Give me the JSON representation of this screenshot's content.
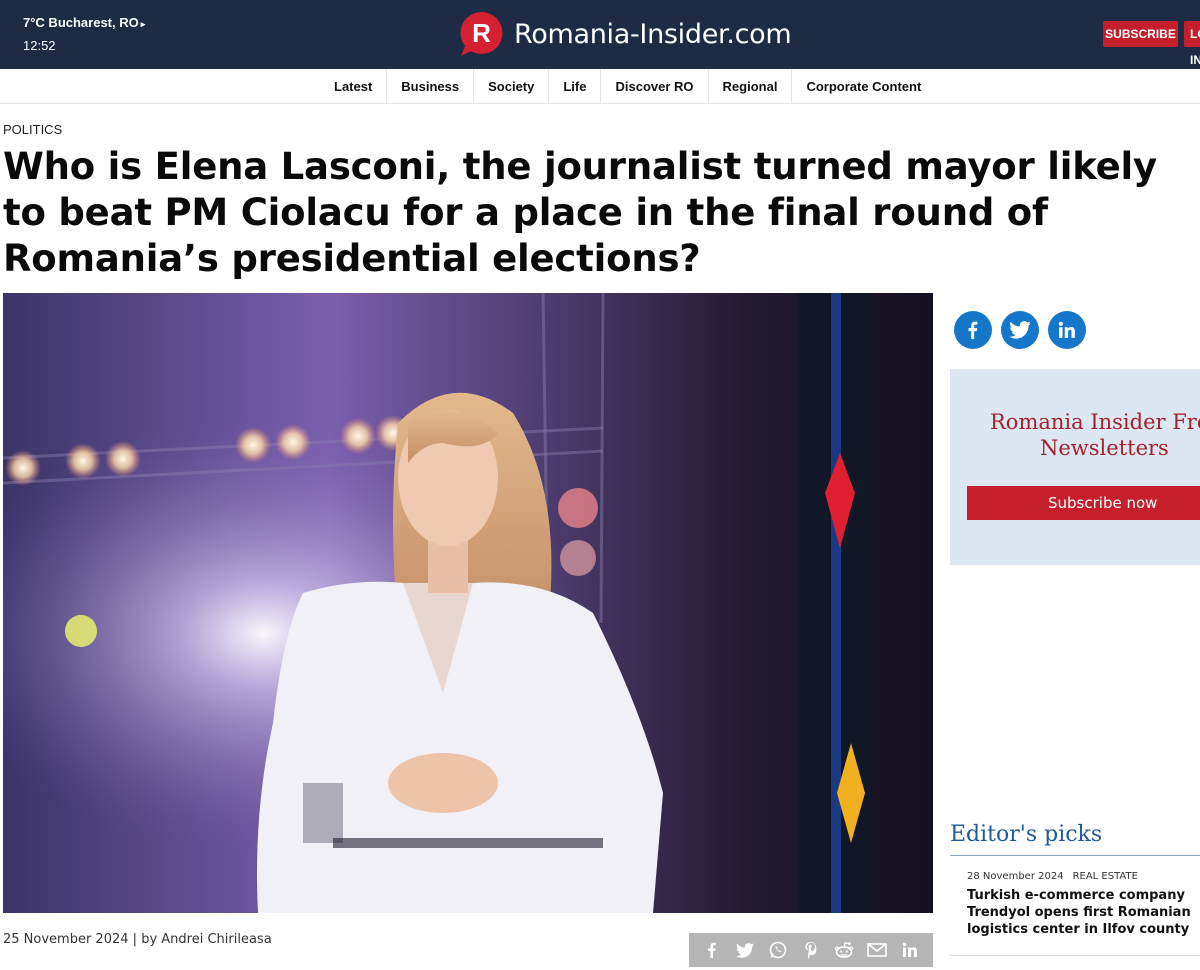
{
  "header": {
    "weather": "7°C Bucharest, RO",
    "weather_arrow": "▸",
    "time": "12:52",
    "logo_letter": "R",
    "site_name": "Romania-Insider.com",
    "subscribe_label": "SUBSCRIBE",
    "login_label": "LOG IN"
  },
  "nav": {
    "items": [
      "Latest",
      "Business",
      "Society",
      "Life",
      "Discover RO",
      "Regional",
      "Corporate Content"
    ]
  },
  "article": {
    "category": "POLITICS",
    "headline": "Who is Elena Lasconi, the journalist turned mayor likely to beat PM Ciolacu for a place in the final round of Romania’s presidential elections?",
    "date": "25 November 2024",
    "author_prefix": "by",
    "author": "Andrei Chirileasa",
    "share_icons": [
      "facebook-icon",
      "twitter-icon",
      "whatsapp-icon",
      "pinterest-icon",
      "reddit-icon",
      "email-icon",
      "linkedin-icon"
    ]
  },
  "sidebar": {
    "social": [
      {
        "icon": "facebook-icon",
        "glyph": "f"
      },
      {
        "icon": "twitter-icon",
        "glyph": ""
      },
      {
        "icon": "linkedin-icon",
        "glyph": "in"
      }
    ],
    "newsletter_line1": "Romania Insider Free",
    "newsletter_line2": "Newsletters",
    "newsletter_button": "Subscribe now",
    "editors_picks_title": "Editor's picks",
    "pick": {
      "date": "28 November 2024",
      "tag": "REAL ESTATE",
      "title": "Turkish e-commerce company Trendyol opens first Romanian logistics center in Ilfov county"
    }
  },
  "colors": {
    "topbar": "#1d2b44",
    "accent_red": "#c41f2b",
    "social_blue": "#1477c9",
    "newsletter_bg": "#dde7f2",
    "picks_blue": "#1f5aa0"
  }
}
